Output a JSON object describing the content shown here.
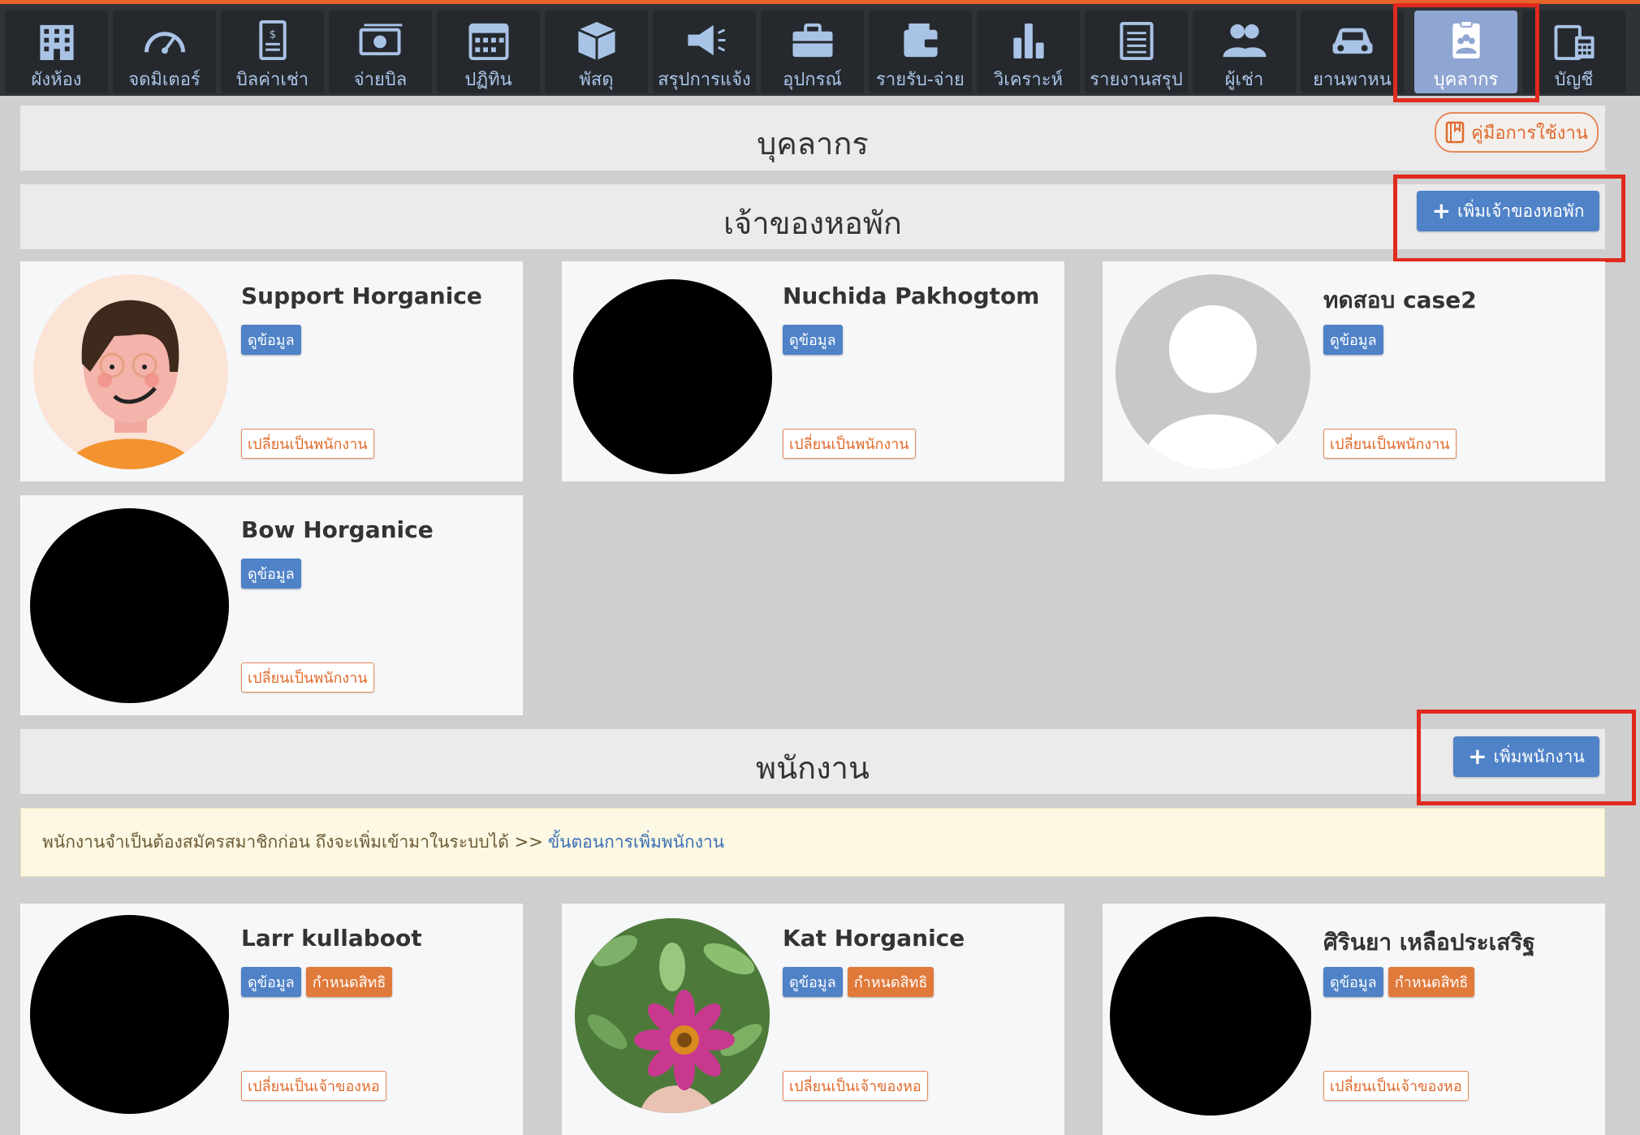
{
  "nav": {
    "items": [
      {
        "label": "ผังห้อง",
        "icon": "building-icon"
      },
      {
        "label": "จดมิเตอร์",
        "icon": "gauge-icon"
      },
      {
        "label": "บิลค่าเช่า",
        "icon": "invoice-icon"
      },
      {
        "label": "จ่ายบิล",
        "icon": "money-icon"
      },
      {
        "label": "ปฏิทิน",
        "icon": "calendar-icon"
      },
      {
        "label": "พัสดุ",
        "icon": "package-icon"
      },
      {
        "label": "สรุปการแจ้ง",
        "icon": "megaphone-icon"
      },
      {
        "label": "อุปกรณ์",
        "icon": "toolbox-icon"
      },
      {
        "label": "รายรับ-จ่าย",
        "icon": "wallet-icon"
      },
      {
        "label": "วิเคราะห์",
        "icon": "bar-chart-icon"
      },
      {
        "label": "รายงานสรุป",
        "icon": "report-icon"
      },
      {
        "label": "ผู้เช่า",
        "icon": "users-icon"
      },
      {
        "label": "ยานพาหน",
        "icon": "car-icon"
      },
      {
        "label": "บุคลากร",
        "icon": "staff-clipboard-icon",
        "active": true
      },
      {
        "label": "บัญชี",
        "icon": "accounting-icon"
      }
    ]
  },
  "page": {
    "title": "บุคลากร",
    "manual_label": "คู่มือการใช้งาน"
  },
  "owners": {
    "title": "เจ้าของหอพัก",
    "add_label": "เพิ่มเจ้าของหอพัก",
    "cards": [
      {
        "name": "Support Horganice",
        "view": "ดูข้อมูล",
        "switch": "เปลี่ยนเป็นพนักงาน",
        "avatar": "cartoon-avatar"
      },
      {
        "name": "Nuchida Pakhogtom",
        "view": "ดูข้อมูล",
        "switch": "เปลี่ยนเป็นพนักงาน",
        "avatar": "redacted"
      },
      {
        "name": "ทดสอบ case2",
        "view": "ดูข้อมูล",
        "switch": "เปลี่ยนเป็นพนักงาน",
        "avatar": "default-avatar"
      },
      {
        "name": "Bow Horganice",
        "view": "ดูข้อมูล",
        "switch": "เปลี่ยนเป็นพนักงาน",
        "avatar": "redacted"
      }
    ]
  },
  "staff": {
    "title": "พนักงาน",
    "add_label": "เพิ่มพนักงาน",
    "notice_text": "พนักงานจำเป็นต้องสมัครสมาชิกก่อน ถึงจะเพิ่มเข้ามาในระบบได้ >>",
    "notice_link": "ขั้นตอนการเพิ่มพนักงาน",
    "cards": [
      {
        "name": "Larr kullaboot",
        "view": "ดูข้อมูล",
        "perm": "กำหนดสิทธิ",
        "switch": "เปลี่ยนเป็นเจ้าของหอ",
        "avatar": "redacted"
      },
      {
        "name": "Kat Horganice",
        "view": "ดูข้อมูล",
        "perm": "กำหนดสิทธิ",
        "switch": "เปลี่ยนเป็นเจ้าของหอ",
        "avatar": "flower-photo"
      },
      {
        "name": "ศิรินยา เหลือประเสริฐ",
        "view": "ดูข้อมูล",
        "perm": "กำหนดสิทธิ",
        "switch": "เปลี่ยนเป็นเจ้าของหอ",
        "avatar": "redacted"
      }
    ]
  },
  "colors": {
    "accent_blue": "#4f82c7",
    "accent_orange": "#e07a3a",
    "highlight_red": "#e02a1d",
    "nav_bg": "#2f3338"
  }
}
